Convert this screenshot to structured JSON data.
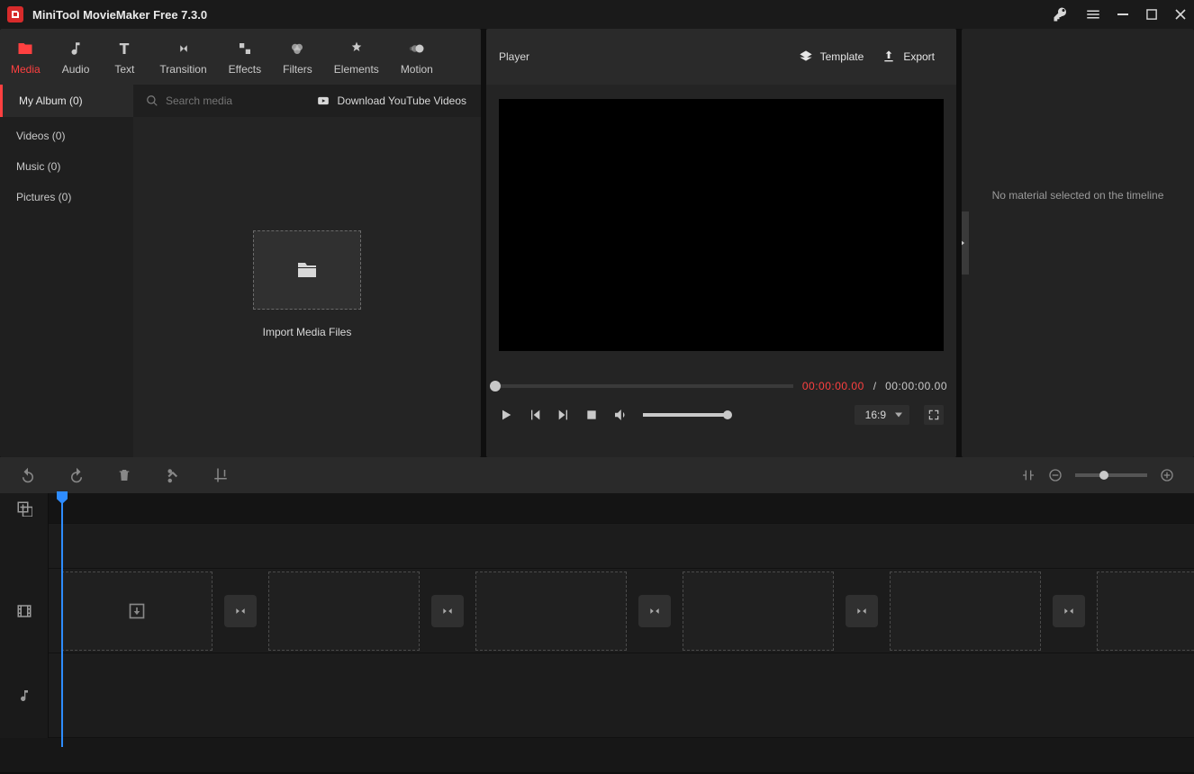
{
  "app": {
    "title": "MiniTool MovieMaker Free 7.3.0"
  },
  "tabs": {
    "media": "Media",
    "audio": "Audio",
    "text": "Text",
    "transition": "Transition",
    "effects": "Effects",
    "filters": "Filters",
    "elements": "Elements",
    "motion": "Motion"
  },
  "sidebar": {
    "my_album": "My Album (0)",
    "videos": "Videos (0)",
    "music": "Music (0)",
    "pictures": "Pictures (0)"
  },
  "search": {
    "placeholder": "Search media"
  },
  "ytlink": "Download YouTube Videos",
  "import_label": "Import Media Files",
  "player": {
    "title": "Player",
    "template": "Template",
    "export": "Export",
    "time_current": "00:00:00.00",
    "time_sep": " / ",
    "time_total": "00:00:00.00",
    "ratio": "16:9"
  },
  "right": {
    "empty": "No material selected on the timeline"
  }
}
